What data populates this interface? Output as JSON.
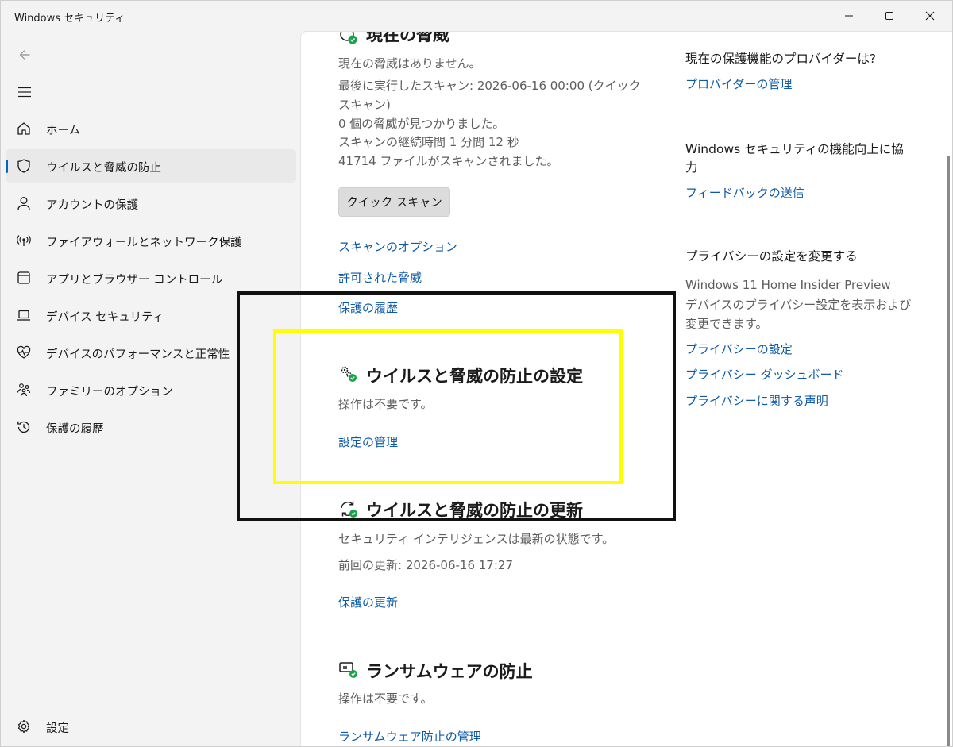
{
  "window": {
    "title": "Windows セキュリティ"
  },
  "nav": {
    "items": [
      {
        "label": "ホーム",
        "icon": "home-icon"
      },
      {
        "label": "ウイルスと脅威の防止",
        "icon": "shield-icon",
        "selected": true
      },
      {
        "label": "アカウントの保護",
        "icon": "person-icon"
      },
      {
        "label": "ファイアウォールとネットワーク保護",
        "icon": "wifi-antenna-icon"
      },
      {
        "label": "アプリとブラウザー コントロール",
        "icon": "app-window-icon"
      },
      {
        "label": "デバイス セキュリティ",
        "icon": "laptop-icon"
      },
      {
        "label": "デバイスのパフォーマンスと正常性",
        "icon": "heart-pulse-icon"
      },
      {
        "label": "ファミリーのオプション",
        "icon": "family-icon"
      },
      {
        "label": "保護の履歴",
        "icon": "history-icon"
      }
    ],
    "settings_label": "設定"
  },
  "current_threats": {
    "title": "現在の脅威",
    "status": "現在の脅威はありません。",
    "last_scan_line1": "最後に実行したスキャン: 2026-06-16 00:00 (クイック",
    "last_scan_line2": "スキャン)",
    "threats_found": "0 個の脅威が見つかりました。",
    "scan_duration": "スキャンの継続時間 1 分間 12 秒",
    "files_scanned": "41714 ファイルがスキャンされました。",
    "quick_scan_label": "クイック スキャン",
    "scan_options_link": "スキャンのオプション",
    "allowed_threats_link": "許可された脅威",
    "protection_history_link": "保護の履歴"
  },
  "settings_section": {
    "title": "ウイルスと脅威の防止の設定",
    "status": "操作は不要です。",
    "manage_link": "設定の管理"
  },
  "updates_section": {
    "title": "ウイルスと脅威の防止の更新",
    "status": "セキュリティ インテリジェンスは最新の状態です。",
    "last_update": "前回の更新: 2026-06-16 17:27",
    "update_link": "保護の更新"
  },
  "ransomware_section": {
    "title": "ランサムウェアの防止",
    "status": "操作は不要です。",
    "manage_link": "ランサムウェア防止の管理"
  },
  "sidebar_right": {
    "provider_title": "現在の保護機能のプロバイダーは?",
    "provider_link": "プロバイダーの管理",
    "improve_title_line1": "Windows セキュリティの機能向上に協",
    "improve_title_line2": "力",
    "feedback_link": "フィードバックの送信",
    "privacy_title": "プライバシーの設定を変更する",
    "privacy_text_line1": "Windows 11 Home Insider Preview",
    "privacy_text_line2": "デバイスのプライバシー設定を表示および",
    "privacy_text_line3": "変更できます。",
    "privacy_settings_link": "プライバシーの設定",
    "privacy_dashboard_link": "プライバシー ダッシュボード",
    "privacy_statement_link": "プライバシーに関する声明"
  },
  "colors": {
    "accent": "#0067c0",
    "link": "#0e5aa7",
    "status_ok": "#16a34a",
    "annotation_black": "#111111",
    "annotation_yellow": "#ffff00"
  }
}
